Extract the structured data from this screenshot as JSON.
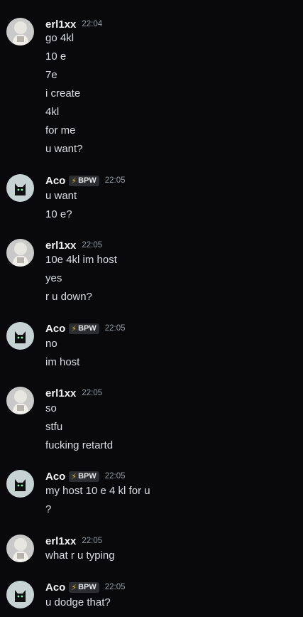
{
  "messages": [
    {
      "author": "erl1xx",
      "tag": "",
      "time": "22:04",
      "lines": [
        "go 4kl",
        "10 e",
        "7e",
        "i create",
        "4kl",
        "for me",
        "u want?"
      ]
    },
    {
      "author": "Aco",
      "tag": "BPW",
      "time": "22:05",
      "lines": [
        "u want",
        "10  e?"
      ]
    },
    {
      "author": "erl1xx",
      "tag": "",
      "time": "22:05",
      "lines": [
        "10e 4kl im host",
        "yes",
        "r u down?"
      ]
    },
    {
      "author": "Aco",
      "tag": "BPW",
      "time": "22:05",
      "lines": [
        "no",
        "im host"
      ]
    },
    {
      "author": "erl1xx",
      "tag": "",
      "time": "22:05",
      "lines": [
        "so",
        "stfu",
        "fucking retartd"
      ]
    },
    {
      "author": "Aco",
      "tag": "BPW",
      "time": "22:05",
      "lines": [
        "my host 10 e 4 kl for u",
        "?"
      ]
    },
    {
      "author": "erl1xx",
      "tag": "",
      "time": "22:05",
      "lines": [
        "what r u typing"
      ]
    },
    {
      "author": "Aco",
      "tag": "BPW",
      "time": "22:05",
      "lines": [
        "u dodge that?"
      ]
    }
  ]
}
